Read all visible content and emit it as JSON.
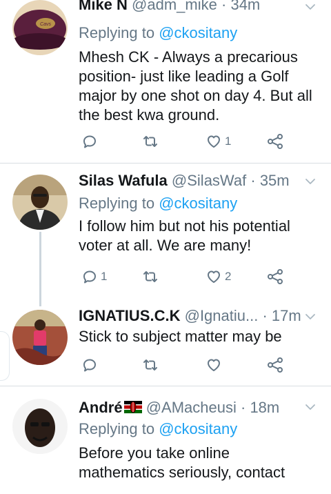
{
  "tweets": [
    {
      "name": "Mike N",
      "handle": "@adm_mike",
      "dot": "·",
      "time": "34m",
      "replying_prefix": "Replying to",
      "replying_to": "@ckositany",
      "text_lines": [
        "Mhesh CK - Always a precarious",
        "position- just like leading a Golf",
        "major by one shot on day 4. But all",
        "the best kwa ground."
      ],
      "reply_count": "",
      "retweet_count": "",
      "like_count": "1"
    },
    {
      "name": "Silas Wafula",
      "handle": "@SilasWaf",
      "dot": "·",
      "time": "35m",
      "replying_prefix": "Replying to",
      "replying_to": "@ckositany",
      "text_lines": [
        "I follow him but not his potential",
        "voter at all. We are many!"
      ],
      "reply_count": "1",
      "retweet_count": "",
      "like_count": "2"
    },
    {
      "name": "IGNATIUS.C.K",
      "handle": "@Ignatiu...",
      "dot": "·",
      "time": "17m",
      "text_lines": [
        "Stick to subject matter may be"
      ],
      "reply_count": "",
      "retweet_count": "",
      "like_count": ""
    },
    {
      "name": "André",
      "handle": "@AMacheusi",
      "dot": "·",
      "time": "18m",
      "replying_prefix": "Replying to",
      "replying_to": "@ckositany",
      "text_lines": [
        "Before you take online",
        "mathematics seriously, contact"
      ]
    }
  ],
  "colors": {
    "link": "#1da1f2",
    "muted": "#657786",
    "text": "#14171a",
    "divider": "#d8dde2"
  },
  "icons": [
    "reply-icon",
    "retweet-icon",
    "like-icon",
    "share-icon",
    "chevron-down-icon",
    "kenya-flag-icon"
  ]
}
